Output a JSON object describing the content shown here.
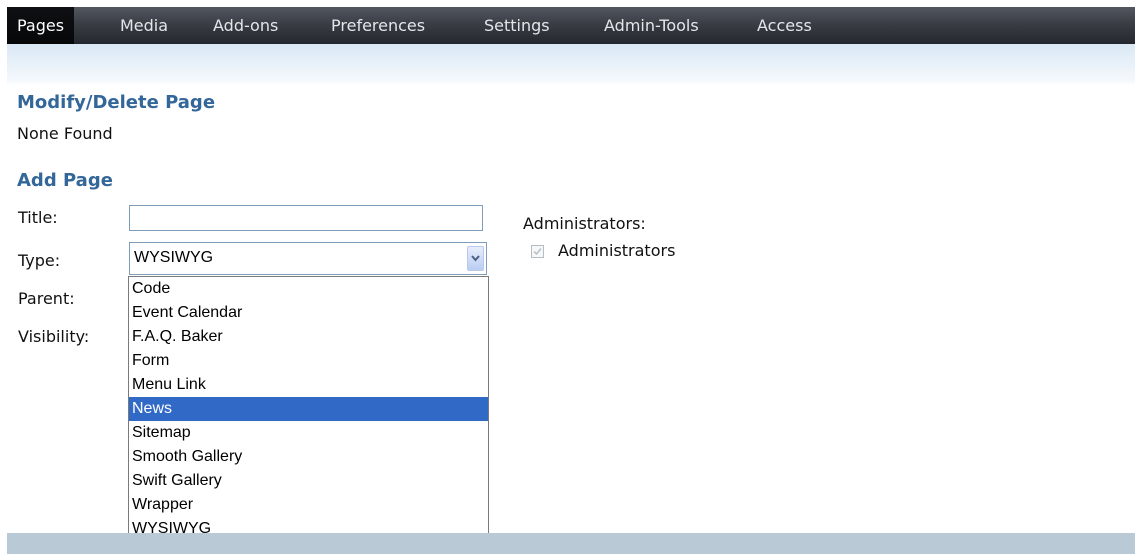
{
  "nav": {
    "items": [
      "Pages",
      "Media",
      "Add-ons",
      "Preferences",
      "Settings",
      "Admin-Tools",
      "Access"
    ],
    "active": "Pages"
  },
  "modify": {
    "heading": "Modify/Delete Page",
    "empty_text": "None Found"
  },
  "add": {
    "heading": "Add Page",
    "title_label": "Title:",
    "title_value": "",
    "type_label": "Type:",
    "type_selected": "WYSIWYG",
    "parent_label": "Parent:",
    "visibility_label": "Visibility:",
    "type_options": [
      "Code",
      "Event Calendar",
      "F.A.Q. Baker",
      "Form",
      "Menu Link",
      "News",
      "Sitemap",
      "Smooth Gallery",
      "Swift Gallery",
      "Wrapper",
      "WYSIWYG"
    ],
    "highlighted_option": "News"
  },
  "admins": {
    "label": "Administrators:",
    "checkbox_label": "Administrators",
    "checked": true,
    "disabled": true
  },
  "colors": {
    "heading": "#336699",
    "highlight": "#3169c6",
    "footer": "#b9c9d6"
  }
}
